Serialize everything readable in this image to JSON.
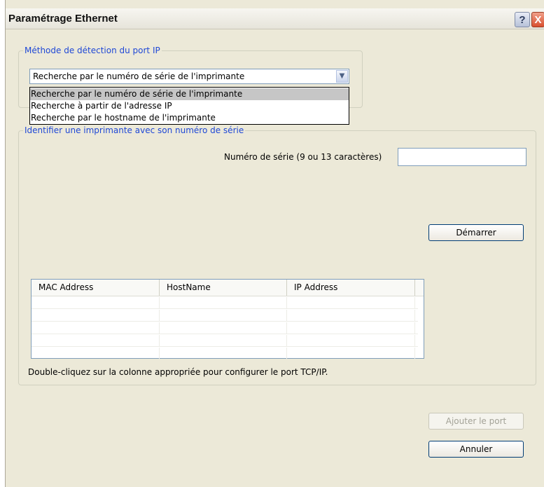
{
  "window": {
    "title": "Paramétrage Ethernet",
    "help_label": "?",
    "close_label": "X"
  },
  "detection": {
    "legend": "Méthode de détection du port IP",
    "selected": "Recherche par le numéro de série de l'imprimante",
    "options": [
      "Recherche par le numéro de série de l'imprimante",
      "Recherche à partir de l'adresse IP",
      "Recherche par le hostname de l'imprimante"
    ]
  },
  "identify": {
    "legend": "Identifier une imprimante avec son numéro de série",
    "serial_label": "Numéro de série (9 ou 13 caractères)",
    "serial_value": "",
    "start_button": "Démarrer",
    "columns": [
      "MAC Address",
      "HostName",
      "IP Address"
    ],
    "rows": [],
    "footnote": "Double-cliquez sur la colonne appropriée pour configurer le port TCP/IP."
  },
  "buttons": {
    "add_port": "Ajouter le port",
    "cancel": "Annuler"
  },
  "colors": {
    "legend_text": "#1f48d6",
    "window_bg": "#ece9d8"
  }
}
